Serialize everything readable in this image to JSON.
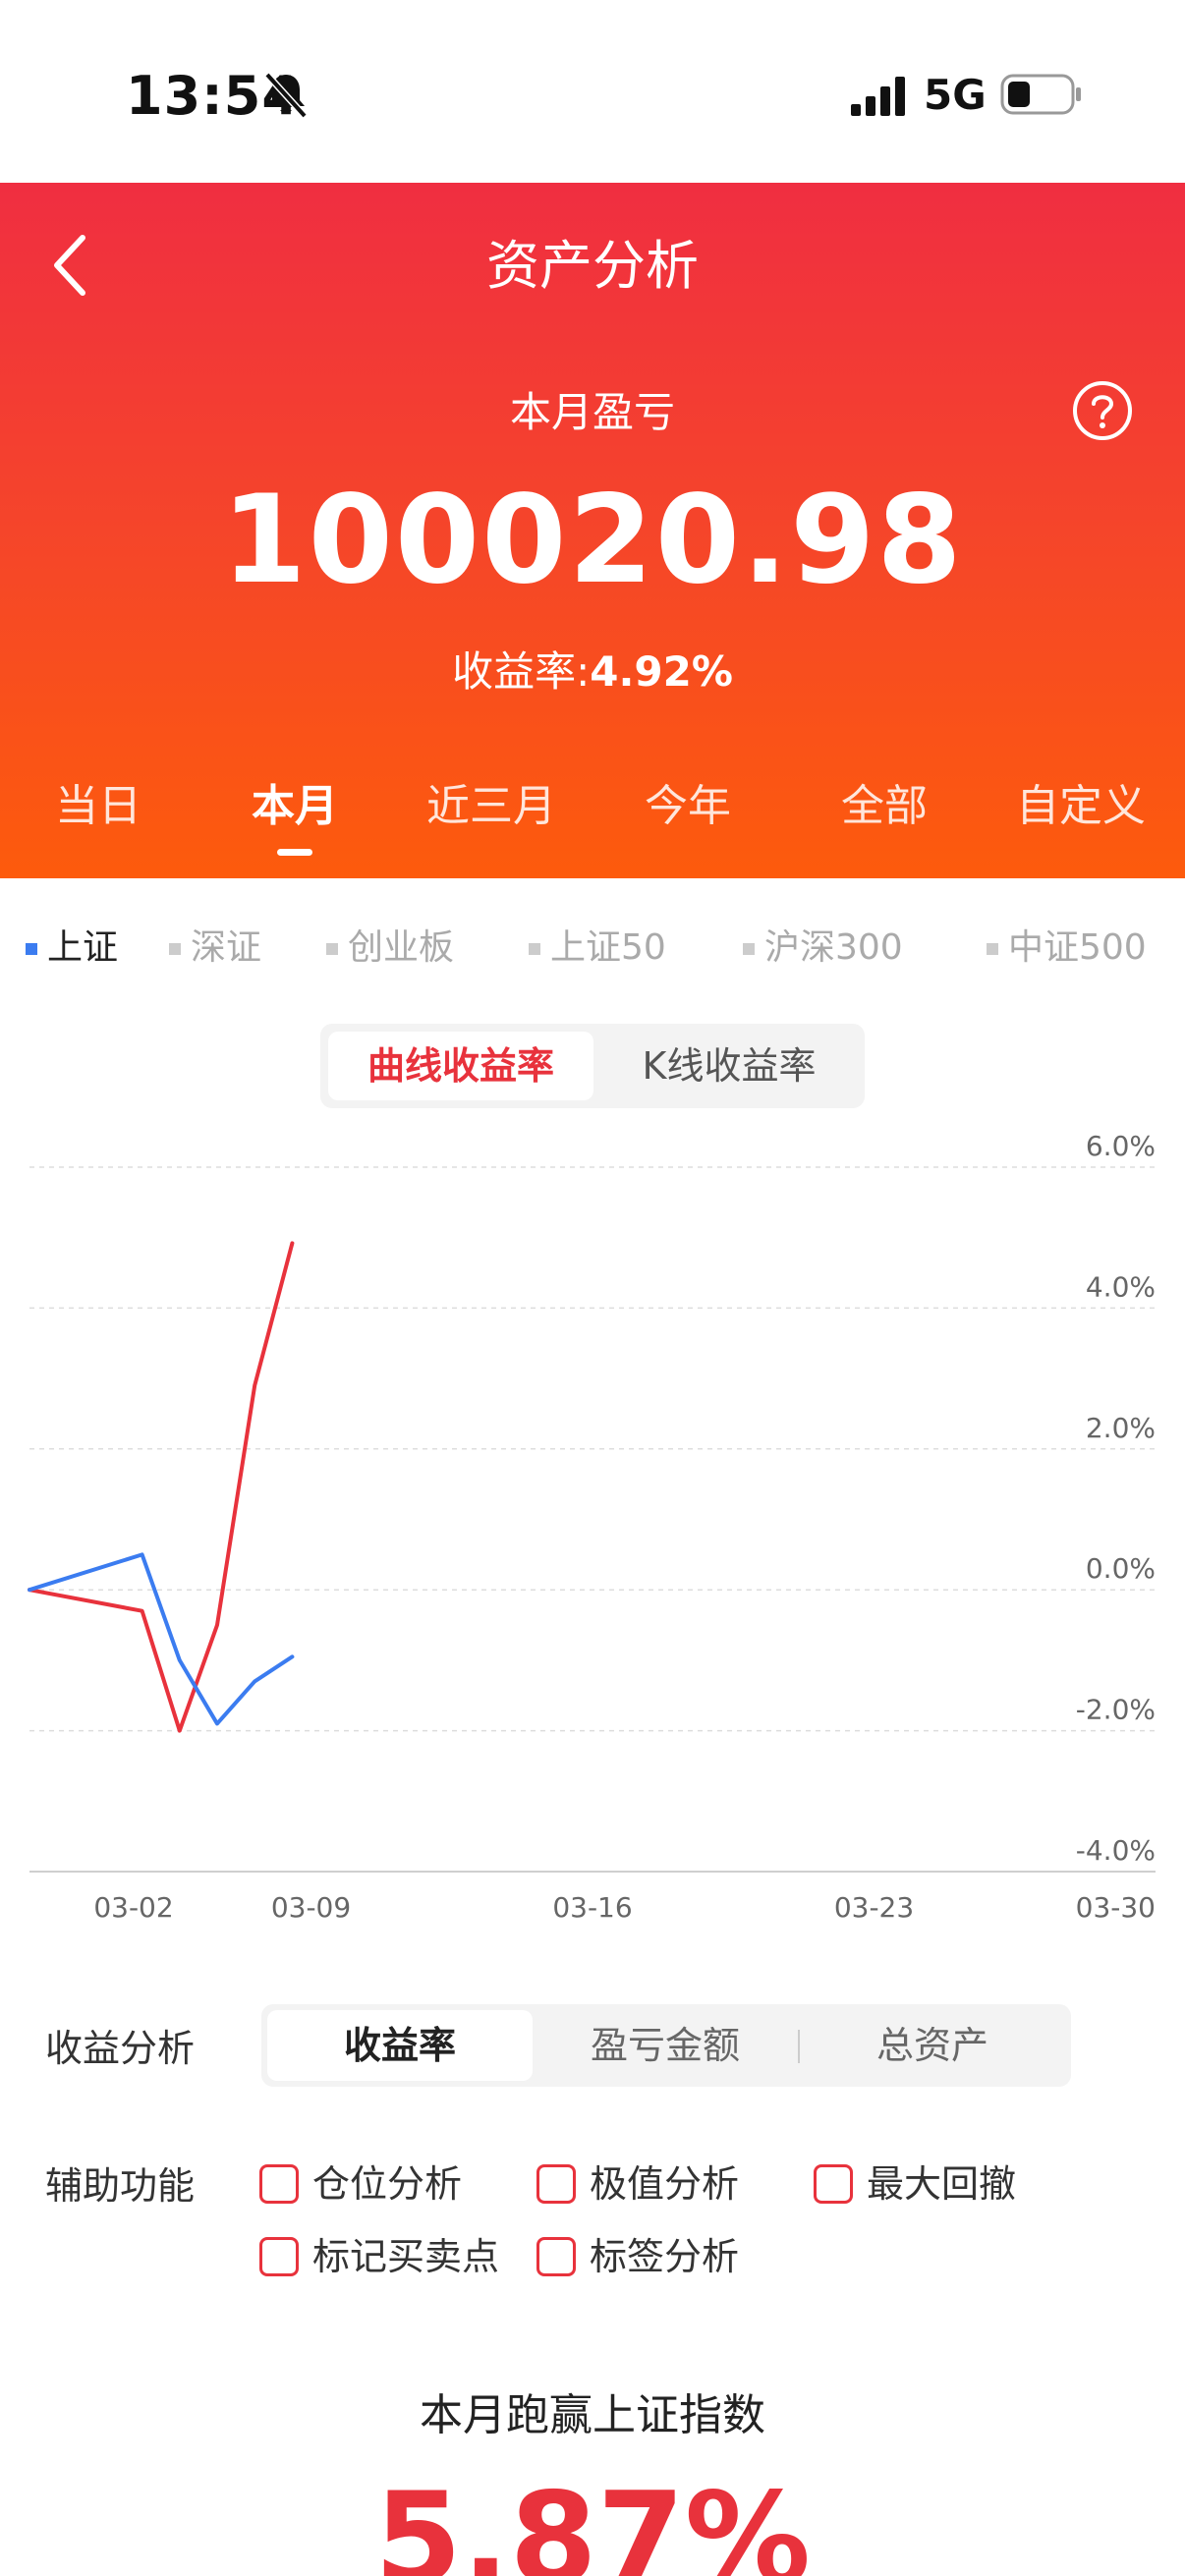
{
  "status_bar": {
    "time": "13:54",
    "network": "5G",
    "icons": [
      "bell-off-icon",
      "signal-icon",
      "battery-icon"
    ]
  },
  "header": {
    "title": "资产分析",
    "back_icon": "chevron-left-icon",
    "help_icon": "question-circle-icon",
    "pl_label": "本月盈亏",
    "pl_value": "100020.98",
    "yield_label": "收益率:",
    "yield_value": "4.92%"
  },
  "period_tabs": [
    "当日",
    "本月",
    "近三月",
    "今年",
    "全部",
    "自定义"
  ],
  "active_period": "本月",
  "index_tabs": [
    "上证",
    "深证",
    "创业板",
    "上证50",
    "沪深300",
    "中证500"
  ],
  "active_index": "上证",
  "chart_toggle": [
    "曲线收益率",
    "K线收益率"
  ],
  "active_chart_toggle": "曲线收益率",
  "colors": {
    "header_top": "#f02e41",
    "header_bottom": "#fd5b0c",
    "accent_red": "#e8323c",
    "index_blue": "#3b7cf0"
  },
  "chart_data": {
    "type": "line",
    "x_ticks": [
      "03-02",
      "03-09",
      "03-16",
      "03-23",
      "03-30"
    ],
    "y_ticks": [
      "6.0%",
      "4.0%",
      "2.0%",
      "0.0%",
      "-2.0%",
      "-4.0%"
    ],
    "ylim": [
      -4.0,
      6.0
    ],
    "xlim": [
      0,
      30
    ],
    "grid": true,
    "series": [
      {
        "name": "本月盈亏",
        "color": "#e8323c",
        "x": [
          0,
          3,
          4,
          5,
          6,
          7
        ],
        "values": [
          0.0,
          -0.3,
          -2.0,
          -0.5,
          2.9,
          4.92
        ]
      },
      {
        "name": "上证",
        "color": "#3b7cf0",
        "x": [
          0,
          3,
          4,
          5,
          6,
          7
        ],
        "values": [
          0.0,
          0.5,
          -1.0,
          -1.9,
          -1.3,
          -0.95
        ]
      }
    ]
  },
  "analysis": {
    "label": "收益分析",
    "segments": [
      "收益率",
      "盈亏金额",
      "总资产"
    ],
    "active_segment": "收益率"
  },
  "aux": {
    "label": "辅助功能",
    "options": [
      "仓位分析",
      "极值分析",
      "最大回撤",
      "标记买卖点",
      "标签分析"
    ]
  },
  "beat": {
    "title": "本月跑赢上证指数",
    "value": "5.87%"
  }
}
